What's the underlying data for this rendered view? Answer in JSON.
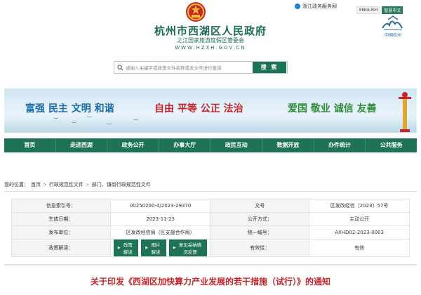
{
  "header": {
    "portal_link": "浙江政务服务网",
    "lang_en": "ENGLISH",
    "lang_cn": "智慧中文",
    "site_title": "杭州市西湖区人民政府",
    "site_subtitle": "之江国家旅游度假区管委会",
    "site_url": "WWW.HZXH.GOV.CN",
    "city_logo_caption": "中国杭州",
    "search_placeholder": "请输入关键字或政策文件名称或发文号进行查询",
    "search_button": "搜 索"
  },
  "banner": {
    "slogan_1": "富强 民主 文明 和谐",
    "slogan_2": "自由 平等 公正 法治",
    "slogan_3": "爱国 敬业 诚信 友善",
    "colors": {
      "slogan_1": "#1c6ea8",
      "slogan_2": "#c1272d",
      "slogan_3": "#2f8a3a"
    }
  },
  "nav": {
    "items": [
      "首页",
      "走进西湖",
      "政务公开",
      "办事大厅",
      "政民互动",
      "数据开放",
      "办件统计",
      "公共服务"
    ]
  },
  "breadcrumb": {
    "prefix": "您的位置：",
    "items": [
      "首页",
      "行政规范性文件",
      "部门、镇街行政规范性文件"
    ]
  },
  "info": {
    "rows": [
      {
        "k1": "信息索引号：",
        "v1": "00250200-4/2023-29370",
        "k2": "文号",
        "v2": "区发改经信〔2023〕57号"
      },
      {
        "k1": "生成日期：",
        "v1": "2023-11-23",
        "k2": "公开方式：",
        "v2": "主动公开"
      },
      {
        "k1": "发布单位：",
        "v1": "区发改经信局（区支援合作局）",
        "k2": "统一编号：",
        "v2": "AXHD02-2023-0003"
      },
      {
        "k1": "政策解读：",
        "v1": "",
        "k2": "有效性：",
        "v2": "有效"
      }
    ],
    "pills": [
      "政策解读",
      "图片解读",
      "意见采纳情况反馈"
    ]
  },
  "article": {
    "title": "关于印发《西湖区加快算力产业发展的若干措施（试行）》的通知"
  },
  "theme": {
    "green": "#1e7356",
    "red": "#c1272d",
    "blue": "#1e7fd0"
  }
}
